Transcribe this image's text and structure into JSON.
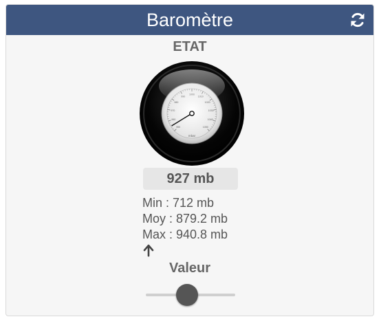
{
  "widget": {
    "title": "Baromètre",
    "refresh_icon": "refresh-icon",
    "state_label": "ETAT",
    "current_value": "927 mb",
    "stats": {
      "min": "Min : 712 mb",
      "avg": "Moy : 879.2 mb",
      "max": "Max : 940.8 mb"
    },
    "trend_icon": "arrow-up-icon",
    "value_label": "Valeur",
    "slider_level": 0.45,
    "colors": {
      "header": "#3e5680",
      "thumb": "#555555"
    }
  },
  "gauge": {
    "unit": "mbar",
    "ticks": [
      "950",
      "960",
      "970",
      "980",
      "990",
      "1000",
      "1010",
      "1020",
      "1030",
      "1040",
      "1050"
    ],
    "needle_value": 955
  }
}
